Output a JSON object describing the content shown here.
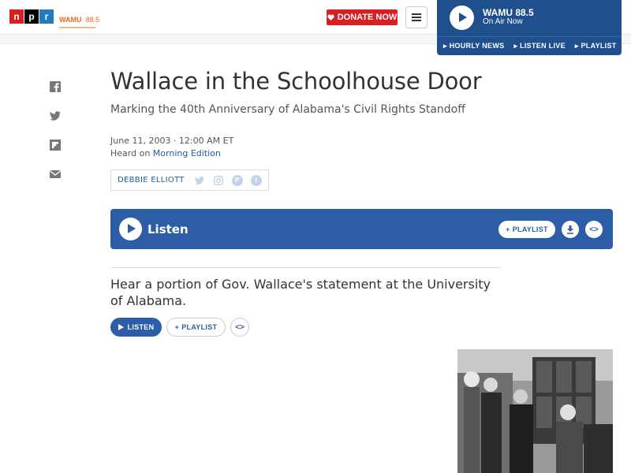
{
  "header": {
    "logo_letters": [
      "n",
      "p",
      "r"
    ],
    "station_logo": {
      "name": "WAMU",
      "freq": "88.5"
    },
    "donate_label": "DONATE NOW",
    "menu_icon": "hamburger-icon"
  },
  "player": {
    "station": "WAMU 88.5",
    "status": "On Air Now",
    "links": [
      "HOURLY NEWS",
      "LISTEN LIVE",
      "PLAYLIST"
    ]
  },
  "share_icons": [
    "facebook-icon",
    "twitter-icon",
    "flipboard-icon",
    "email-icon"
  ],
  "article": {
    "title": "Wallace in the Schoolhouse Door",
    "subtitle": "Marking the 40th Anniversary of Alabama's Civil Rights Standoff",
    "date": "June 11, 2003 · 12:00 AM ET",
    "heard_on_prefix": "Heard on ",
    "heard_on_show": "Morning Edition",
    "author": "DEBBIE ELLIOTT",
    "author_social": [
      "twitter-icon",
      "instagram-icon",
      "podcast-icon",
      "tumblr-icon"
    ]
  },
  "listen_bar": {
    "label": "Listen",
    "playlist_label": "PLAYLIST",
    "download_icon": "download-icon",
    "embed_icon": "embed-icon"
  },
  "audio_item": {
    "caption": "Hear a portion of Gov. Wallace's statement at the University of Alabama.",
    "listen_label": "LISTEN",
    "playlist_label": "PLAYLIST"
  },
  "colors": {
    "npr_red": "#d62021",
    "npr_blue": "#237bbd",
    "player_blue": "#1f4f8c",
    "listen_blue": "#2c5da6",
    "wamu_orange": "#f26522"
  }
}
